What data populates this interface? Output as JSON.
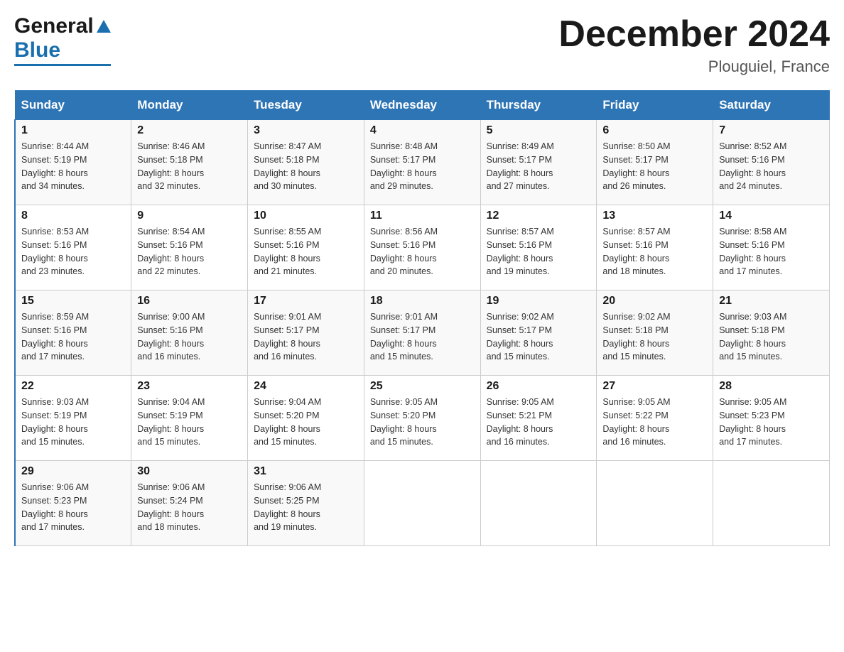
{
  "header": {
    "logo": {
      "general": "General",
      "blue": "Blue",
      "tagline": "GeneralBlue"
    },
    "title": "December 2024",
    "location": "Plouguiel, France"
  },
  "days_of_week": [
    "Sunday",
    "Monday",
    "Tuesday",
    "Wednesday",
    "Thursday",
    "Friday",
    "Saturday"
  ],
  "weeks": [
    [
      {
        "day": "1",
        "sunrise": "Sunrise: 8:44 AM",
        "sunset": "Sunset: 5:19 PM",
        "daylight": "Daylight: 8 hours",
        "daylight2": "and 34 minutes."
      },
      {
        "day": "2",
        "sunrise": "Sunrise: 8:46 AM",
        "sunset": "Sunset: 5:18 PM",
        "daylight": "Daylight: 8 hours",
        "daylight2": "and 32 minutes."
      },
      {
        "day": "3",
        "sunrise": "Sunrise: 8:47 AM",
        "sunset": "Sunset: 5:18 PM",
        "daylight": "Daylight: 8 hours",
        "daylight2": "and 30 minutes."
      },
      {
        "day": "4",
        "sunrise": "Sunrise: 8:48 AM",
        "sunset": "Sunset: 5:17 PM",
        "daylight": "Daylight: 8 hours",
        "daylight2": "and 29 minutes."
      },
      {
        "day": "5",
        "sunrise": "Sunrise: 8:49 AM",
        "sunset": "Sunset: 5:17 PM",
        "daylight": "Daylight: 8 hours",
        "daylight2": "and 27 minutes."
      },
      {
        "day": "6",
        "sunrise": "Sunrise: 8:50 AM",
        "sunset": "Sunset: 5:17 PM",
        "daylight": "Daylight: 8 hours",
        "daylight2": "and 26 minutes."
      },
      {
        "day": "7",
        "sunrise": "Sunrise: 8:52 AM",
        "sunset": "Sunset: 5:16 PM",
        "daylight": "Daylight: 8 hours",
        "daylight2": "and 24 minutes."
      }
    ],
    [
      {
        "day": "8",
        "sunrise": "Sunrise: 8:53 AM",
        "sunset": "Sunset: 5:16 PM",
        "daylight": "Daylight: 8 hours",
        "daylight2": "and 23 minutes."
      },
      {
        "day": "9",
        "sunrise": "Sunrise: 8:54 AM",
        "sunset": "Sunset: 5:16 PM",
        "daylight": "Daylight: 8 hours",
        "daylight2": "and 22 minutes."
      },
      {
        "day": "10",
        "sunrise": "Sunrise: 8:55 AM",
        "sunset": "Sunset: 5:16 PM",
        "daylight": "Daylight: 8 hours",
        "daylight2": "and 21 minutes."
      },
      {
        "day": "11",
        "sunrise": "Sunrise: 8:56 AM",
        "sunset": "Sunset: 5:16 PM",
        "daylight": "Daylight: 8 hours",
        "daylight2": "and 20 minutes."
      },
      {
        "day": "12",
        "sunrise": "Sunrise: 8:57 AM",
        "sunset": "Sunset: 5:16 PM",
        "daylight": "Daylight: 8 hours",
        "daylight2": "and 19 minutes."
      },
      {
        "day": "13",
        "sunrise": "Sunrise: 8:57 AM",
        "sunset": "Sunset: 5:16 PM",
        "daylight": "Daylight: 8 hours",
        "daylight2": "and 18 minutes."
      },
      {
        "day": "14",
        "sunrise": "Sunrise: 8:58 AM",
        "sunset": "Sunset: 5:16 PM",
        "daylight": "Daylight: 8 hours",
        "daylight2": "and 17 minutes."
      }
    ],
    [
      {
        "day": "15",
        "sunrise": "Sunrise: 8:59 AM",
        "sunset": "Sunset: 5:16 PM",
        "daylight": "Daylight: 8 hours",
        "daylight2": "and 17 minutes."
      },
      {
        "day": "16",
        "sunrise": "Sunrise: 9:00 AM",
        "sunset": "Sunset: 5:16 PM",
        "daylight": "Daylight: 8 hours",
        "daylight2": "and 16 minutes."
      },
      {
        "day": "17",
        "sunrise": "Sunrise: 9:01 AM",
        "sunset": "Sunset: 5:17 PM",
        "daylight": "Daylight: 8 hours",
        "daylight2": "and 16 minutes."
      },
      {
        "day": "18",
        "sunrise": "Sunrise: 9:01 AM",
        "sunset": "Sunset: 5:17 PM",
        "daylight": "Daylight: 8 hours",
        "daylight2": "and 15 minutes."
      },
      {
        "day": "19",
        "sunrise": "Sunrise: 9:02 AM",
        "sunset": "Sunset: 5:17 PM",
        "daylight": "Daylight: 8 hours",
        "daylight2": "and 15 minutes."
      },
      {
        "day": "20",
        "sunrise": "Sunrise: 9:02 AM",
        "sunset": "Sunset: 5:18 PM",
        "daylight": "Daylight: 8 hours",
        "daylight2": "and 15 minutes."
      },
      {
        "day": "21",
        "sunrise": "Sunrise: 9:03 AM",
        "sunset": "Sunset: 5:18 PM",
        "daylight": "Daylight: 8 hours",
        "daylight2": "and 15 minutes."
      }
    ],
    [
      {
        "day": "22",
        "sunrise": "Sunrise: 9:03 AM",
        "sunset": "Sunset: 5:19 PM",
        "daylight": "Daylight: 8 hours",
        "daylight2": "and 15 minutes."
      },
      {
        "day": "23",
        "sunrise": "Sunrise: 9:04 AM",
        "sunset": "Sunset: 5:19 PM",
        "daylight": "Daylight: 8 hours",
        "daylight2": "and 15 minutes."
      },
      {
        "day": "24",
        "sunrise": "Sunrise: 9:04 AM",
        "sunset": "Sunset: 5:20 PM",
        "daylight": "Daylight: 8 hours",
        "daylight2": "and 15 minutes."
      },
      {
        "day": "25",
        "sunrise": "Sunrise: 9:05 AM",
        "sunset": "Sunset: 5:20 PM",
        "daylight": "Daylight: 8 hours",
        "daylight2": "and 15 minutes."
      },
      {
        "day": "26",
        "sunrise": "Sunrise: 9:05 AM",
        "sunset": "Sunset: 5:21 PM",
        "daylight": "Daylight: 8 hours",
        "daylight2": "and 16 minutes."
      },
      {
        "day": "27",
        "sunrise": "Sunrise: 9:05 AM",
        "sunset": "Sunset: 5:22 PM",
        "daylight": "Daylight: 8 hours",
        "daylight2": "and 16 minutes."
      },
      {
        "day": "28",
        "sunrise": "Sunrise: 9:05 AM",
        "sunset": "Sunset: 5:23 PM",
        "daylight": "Daylight: 8 hours",
        "daylight2": "and 17 minutes."
      }
    ],
    [
      {
        "day": "29",
        "sunrise": "Sunrise: 9:06 AM",
        "sunset": "Sunset: 5:23 PM",
        "daylight": "Daylight: 8 hours",
        "daylight2": "and 17 minutes."
      },
      {
        "day": "30",
        "sunrise": "Sunrise: 9:06 AM",
        "sunset": "Sunset: 5:24 PM",
        "daylight": "Daylight: 8 hours",
        "daylight2": "and 18 minutes."
      },
      {
        "day": "31",
        "sunrise": "Sunrise: 9:06 AM",
        "sunset": "Sunset: 5:25 PM",
        "daylight": "Daylight: 8 hours",
        "daylight2": "and 19 minutes."
      },
      null,
      null,
      null,
      null
    ]
  ]
}
